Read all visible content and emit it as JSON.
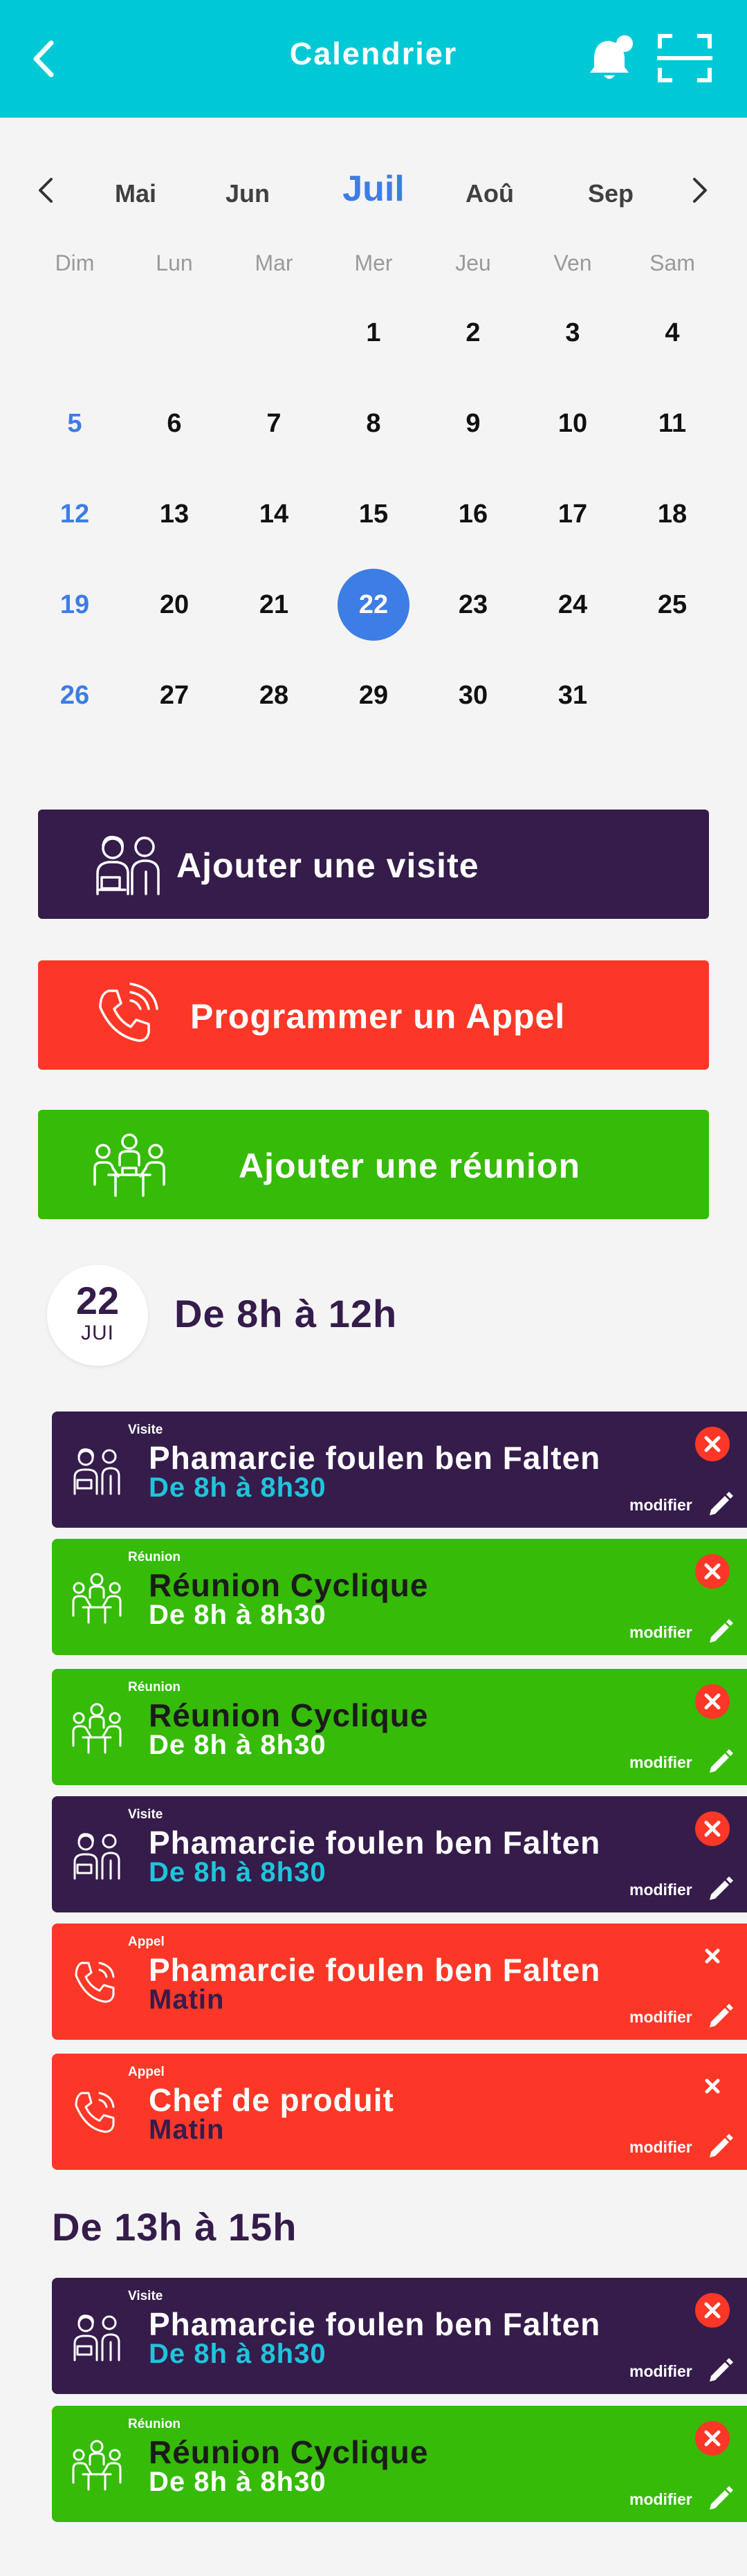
{
  "header": {
    "title": "Calendrier",
    "back_icon": "chevron-left-icon",
    "notification_icon": "bell-icon",
    "scan_icon": "scan-frame-icon"
  },
  "calendar": {
    "months": [
      "Mai",
      "Jun",
      "Juil",
      "Aoû",
      "Sep"
    ],
    "active_month": "Juil",
    "weekdays": [
      "Dim",
      "Lun",
      "Mar",
      "Mer",
      "Jeu",
      "Ven",
      "Sam"
    ],
    "weeks": [
      [
        "",
        "",
        "",
        "1",
        "2",
        "3",
        "4"
      ],
      [
        "5",
        "6",
        "7",
        "8",
        "9",
        "10",
        "11"
      ],
      [
        "12",
        "13",
        "14",
        "15",
        "16",
        "17",
        "18"
      ],
      [
        "19",
        "20",
        "21",
        "22",
        "23",
        "24",
        "25"
      ],
      [
        "26",
        "27",
        "28",
        "29",
        "30",
        "31",
        ""
      ]
    ],
    "selected_day": "22",
    "colors": {
      "accent": "#3d7de6",
      "header": "#00c9d6"
    }
  },
  "actions": {
    "visit": "Ajouter une visite",
    "call": "Programmer un Appel",
    "meeting": "Ajouter une réunion",
    "colors": {
      "visit": "#351c4b",
      "call": "#fc3727",
      "meeting": "#35bb08"
    }
  },
  "selected_date": {
    "day": "22",
    "month": "JUI"
  },
  "slots": [
    {
      "title": "De 8h à 12h",
      "events": [
        {
          "kind": "visite",
          "type": "Visite",
          "name": "Phamarcie foulen ben Falten",
          "time": "De 8h à 8h30",
          "edit": "modifier"
        },
        {
          "kind": "reunion",
          "type": "Réunion",
          "name": "Réunion Cyclique",
          "time": "De 8h à 8h30",
          "edit": "modifier"
        },
        {
          "kind": "reunion",
          "type": "Réunion",
          "name": "Réunion Cyclique",
          "time": "De 8h à 8h30",
          "edit": "modifier"
        },
        {
          "kind": "visite",
          "type": "Visite",
          "name": "Phamarcie foulen ben Falten",
          "time": "De 8h à 8h30",
          "edit": "modifier"
        },
        {
          "kind": "appel",
          "type": "Appel",
          "name": "Phamarcie foulen ben Falten",
          "time": "Matin",
          "edit": "modifier"
        },
        {
          "kind": "appel",
          "type": "Appel",
          "name": "Chef de produit",
          "time": "Matin",
          "edit": "modifier"
        }
      ]
    },
    {
      "title": "De 13h à 15h",
      "events": [
        {
          "kind": "visite",
          "type": "Visite",
          "name": "Phamarcie foulen ben Falten",
          "time": "De 8h à 8h30",
          "edit": "modifier"
        },
        {
          "kind": "reunion",
          "type": "Réunion",
          "name": "Réunion Cyclique",
          "time": "De 8h à 8h30",
          "edit": "modifier"
        }
      ]
    }
  ]
}
